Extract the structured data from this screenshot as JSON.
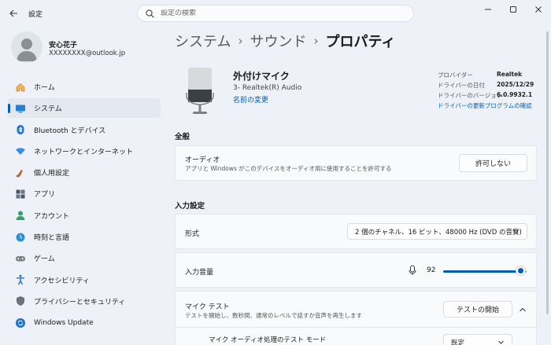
{
  "app": {
    "title": "設定"
  },
  "search": {
    "placeholder": "設定の検索"
  },
  "user": {
    "name": "安心花子",
    "email": "XXXXXXXX@outlook.jp"
  },
  "nav": {
    "items": [
      {
        "label": "ホーム",
        "icon": "home-icon"
      },
      {
        "label": "システム",
        "icon": "system-icon"
      },
      {
        "label": "Bluetooth とデバイス",
        "icon": "bluetooth-icon"
      },
      {
        "label": "ネットワークとインターネット",
        "icon": "network-icon"
      },
      {
        "label": "個人用設定",
        "icon": "personalization-icon"
      },
      {
        "label": "アプリ",
        "icon": "apps-icon"
      },
      {
        "label": "アカウント",
        "icon": "account-icon"
      },
      {
        "label": "時刻と言語",
        "icon": "time-language-icon"
      },
      {
        "label": "ゲーム",
        "icon": "gaming-icon"
      },
      {
        "label": "アクセシビリティ",
        "icon": "accessibility-icon"
      },
      {
        "label": "プライバシーとセキュリティ",
        "icon": "privacy-icon"
      },
      {
        "label": "Windows Update",
        "icon": "windows-update-icon"
      }
    ],
    "active_index": 1
  },
  "breadcrumb": {
    "part1": "システム",
    "part2": "サウンド",
    "current": "プロパティ",
    "separator": "›"
  },
  "device": {
    "name": "外付けマイク",
    "subtitle": "3- Realtek(R) Audio",
    "rename_link": "名前の変更",
    "driver": {
      "provider_label": "プロバイダー",
      "provider_value": "Realtek",
      "date_label": "ドライバーの日付",
      "date_value": "2025/12/29",
      "version_label": "ドライバーのバージョン",
      "version_value": "6.0.9932.1",
      "update_link": "ドライバーの更新プログラムの確認"
    }
  },
  "general": {
    "section_title": "全般",
    "audio_title": "オーディオ",
    "audio_desc": "アプリと Windows がこのデバイスをオーディオ用に使用することを許可する",
    "audio_button": "許可しない"
  },
  "input": {
    "section_title": "入力設定",
    "format_label": "形式",
    "format_value": "2 個のチャネル、16 ビット、48000 Hz (DVD の音質)",
    "volume_label": "入力音量",
    "volume_value": "92",
    "volume_fraction": 0.92,
    "mic_test_title": "マイク テスト",
    "mic_test_desc": "テストを開始し、数秒間、通常のレベルで話すか音声を再生します",
    "mic_test_button": "テストの開始",
    "mode_label": "マイク オーディオ処理のテスト モード",
    "mode_value": "既定"
  },
  "colors": {
    "accent": "#005fb8",
    "background": "#eef1f7",
    "card": "#f9fafc"
  }
}
